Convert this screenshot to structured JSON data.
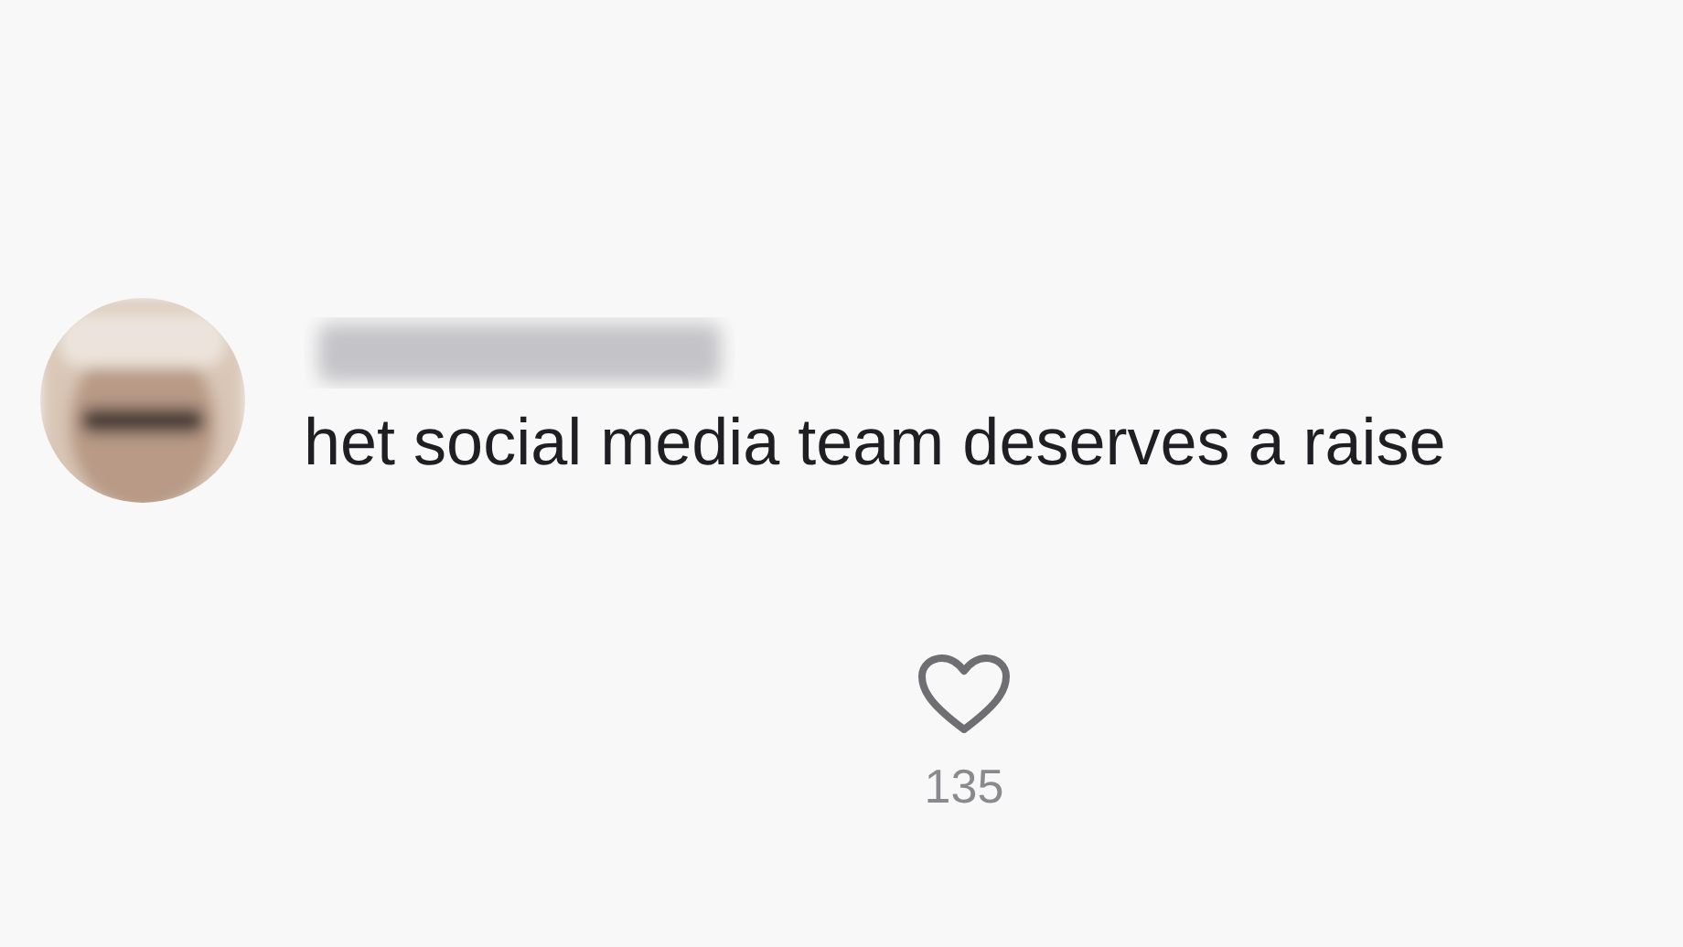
{
  "comment": {
    "text": "het social media team deserves a raise",
    "likes": "135"
  }
}
